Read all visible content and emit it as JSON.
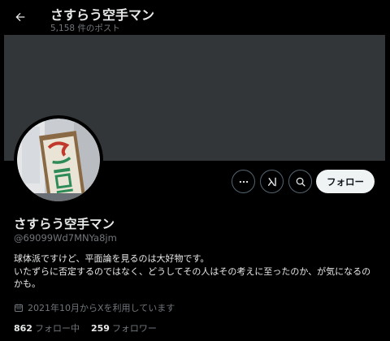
{
  "header": {
    "title": "さすらう空手マン",
    "post_count": "5,158 件のポスト"
  },
  "profile": {
    "name": "さすらう空手マン",
    "handle": "@69099Wd7MNYa8jm",
    "bio": [
      "球体派ですけど、平面論を見るのは大好物です。",
      "いたずらに否定するのではなく、どうしてその人はその考えに至ったのか、が気になるの",
      "かも。"
    ],
    "joined": "2021年10月からXを利用しています",
    "following_count": "862",
    "following_label": "フォロー中",
    "followers_count": "259",
    "followers_label": "フォロワー"
  },
  "actions": {
    "follow_label": "フォロー"
  },
  "icons": {
    "back": "arrow-left-icon",
    "more": "more-horizontal-icon",
    "grok": "grok-icon",
    "search": "search-icon",
    "calendar": "calendar-icon"
  },
  "colors": {
    "background": "#000000",
    "banner": "#333639",
    "text_primary": "#e7e9ea",
    "text_secondary": "#71767b",
    "follow_button_bg": "#eff3f4",
    "follow_button_text": "#0f1419",
    "outline_button_border": "#536471"
  }
}
